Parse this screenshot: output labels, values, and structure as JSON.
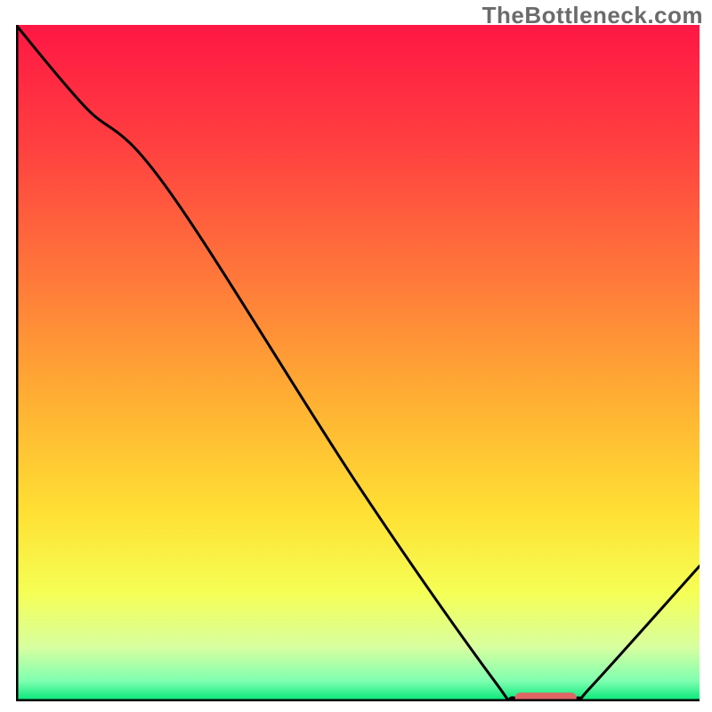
{
  "watermark": {
    "text": "TheBottleneck.com"
  },
  "chart_data": {
    "type": "line",
    "title": "",
    "xlabel": "",
    "ylabel": "",
    "xlim": [
      0,
      100
    ],
    "ylim": [
      0,
      100
    ],
    "series": [
      {
        "name": "curve",
        "x": [
          0,
          10,
          22,
          50,
          70,
          73,
          82,
          84,
          100
        ],
        "y": [
          100,
          88,
          76,
          32,
          3,
          0.5,
          0.5,
          2,
          20
        ]
      }
    ],
    "marker": {
      "name": "optimal-range",
      "x": [
        73,
        82
      ],
      "y": 0.5,
      "color": "#e06666"
    },
    "gradient_stops": [
      {
        "pos": 0.0,
        "color": "#ff1744"
      },
      {
        "pos": 0.18,
        "color": "#ff4040"
      },
      {
        "pos": 0.38,
        "color": "#ff7a3a"
      },
      {
        "pos": 0.55,
        "color": "#ffae33"
      },
      {
        "pos": 0.72,
        "color": "#ffe033"
      },
      {
        "pos": 0.84,
        "color": "#f5ff55"
      },
      {
        "pos": 0.92,
        "color": "#d8ffa0"
      },
      {
        "pos": 0.97,
        "color": "#7fffb0"
      },
      {
        "pos": 1.0,
        "color": "#00e676"
      }
    ]
  }
}
